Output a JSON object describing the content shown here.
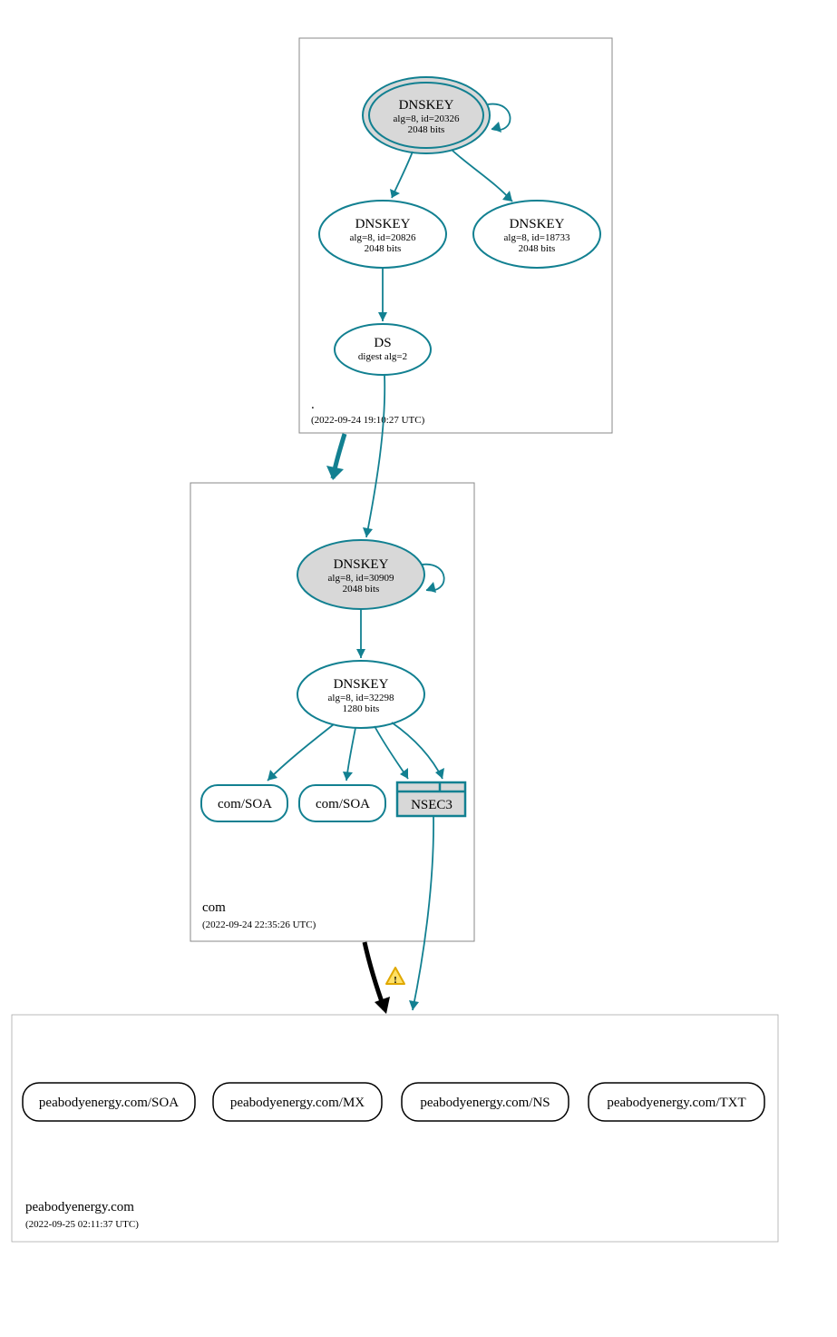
{
  "zones": {
    "root": {
      "label": ".",
      "timestamp": "(2022-09-24 19:10:27 UTC)",
      "nodes": {
        "dnskey_ksk": {
          "title": "DNSKEY",
          "line1": "alg=8, id=20326",
          "line2": "2048 bits"
        },
        "dnskey_zsk": {
          "title": "DNSKEY",
          "line1": "alg=8, id=20826",
          "line2": "2048 bits"
        },
        "dnskey_aux": {
          "title": "DNSKEY",
          "line1": "alg=8, id=18733",
          "line2": "2048 bits"
        },
        "ds": {
          "title": "DS",
          "line1": "digest alg=2"
        }
      }
    },
    "com": {
      "label": "com",
      "timestamp": "(2022-09-24 22:35:26 UTC)",
      "nodes": {
        "dnskey_ksk": {
          "title": "DNSKEY",
          "line1": "alg=8, id=30909",
          "line2": "2048 bits"
        },
        "dnskey_zsk": {
          "title": "DNSKEY",
          "line1": "alg=8, id=32298",
          "line2": "1280 bits"
        },
        "soa1": {
          "label": "com/SOA"
        },
        "soa2": {
          "label": "com/SOA"
        },
        "nsec3": {
          "label": "NSEC3"
        }
      }
    },
    "leaf": {
      "label": "peabodyenergy.com",
      "timestamp": "(2022-09-25 02:11:37 UTC)",
      "records": {
        "soa": "peabodyenergy.com/SOA",
        "mx": "peabodyenergy.com/MX",
        "ns": "peabodyenergy.com/NS",
        "txt": "peabodyenergy.com/TXT"
      }
    }
  },
  "warning_glyph": "!"
}
